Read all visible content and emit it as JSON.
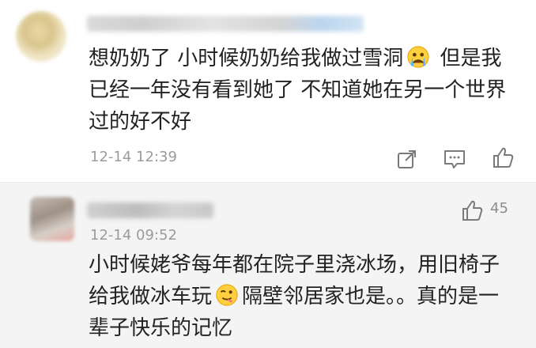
{
  "comments": [
    {
      "text": "想奶奶了 小时候奶奶给我做过雪洞",
      "text_after_emoji": " 但是我已经一年没有看到她了 不知道她在另一个世界过的好不好",
      "emoji": "crying-face-icon",
      "timestamp": "12-14 12:39",
      "actions": [
        "share-icon",
        "comment-icon",
        "like-icon"
      ]
    },
    {
      "text": "小时候姥爷每年都在院子里浇冰场，用旧椅子给我做冰车玩",
      "text_after_emoji": "隔壁邻居家也是。。真的是一辈子快乐的记忆",
      "emoji": "tongue-out-face-icon",
      "timestamp": "12-14 09:52",
      "like_count": "45"
    }
  ],
  "colors": {
    "background": "#ffffff",
    "reply_background": "#f4f4f4",
    "text": "#222222",
    "meta": "#9b9b9b",
    "icon": "#7a7a7a"
  }
}
